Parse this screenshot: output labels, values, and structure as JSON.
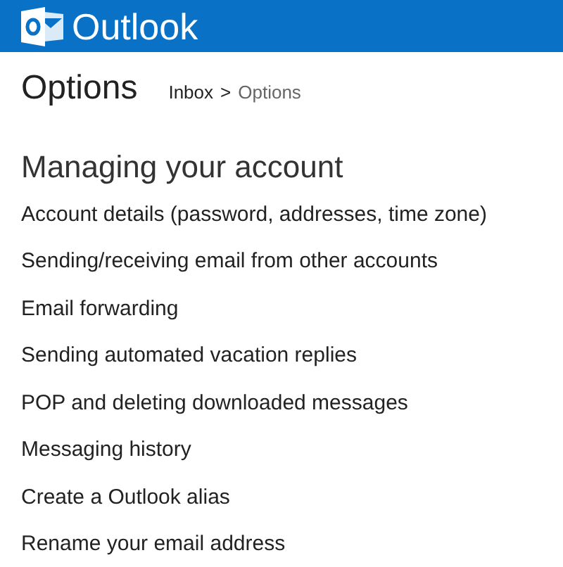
{
  "header": {
    "brand": "Outlook"
  },
  "page": {
    "title": "Options",
    "breadcrumb": [
      {
        "label": "Inbox",
        "kind": "link"
      },
      {
        "label": ">",
        "kind": "separator"
      },
      {
        "label": "Options",
        "kind": "current"
      }
    ]
  },
  "section": {
    "heading": "Managing your account",
    "links": [
      "Account details (password, addresses, time zone)",
      "Sending/receiving email from other accounts",
      "Email forwarding",
      "Sending automated vacation replies",
      "POP and deleting downloaded messages",
      "Messaging history",
      "Create a Outlook alias",
      "Rename your email address"
    ]
  }
}
